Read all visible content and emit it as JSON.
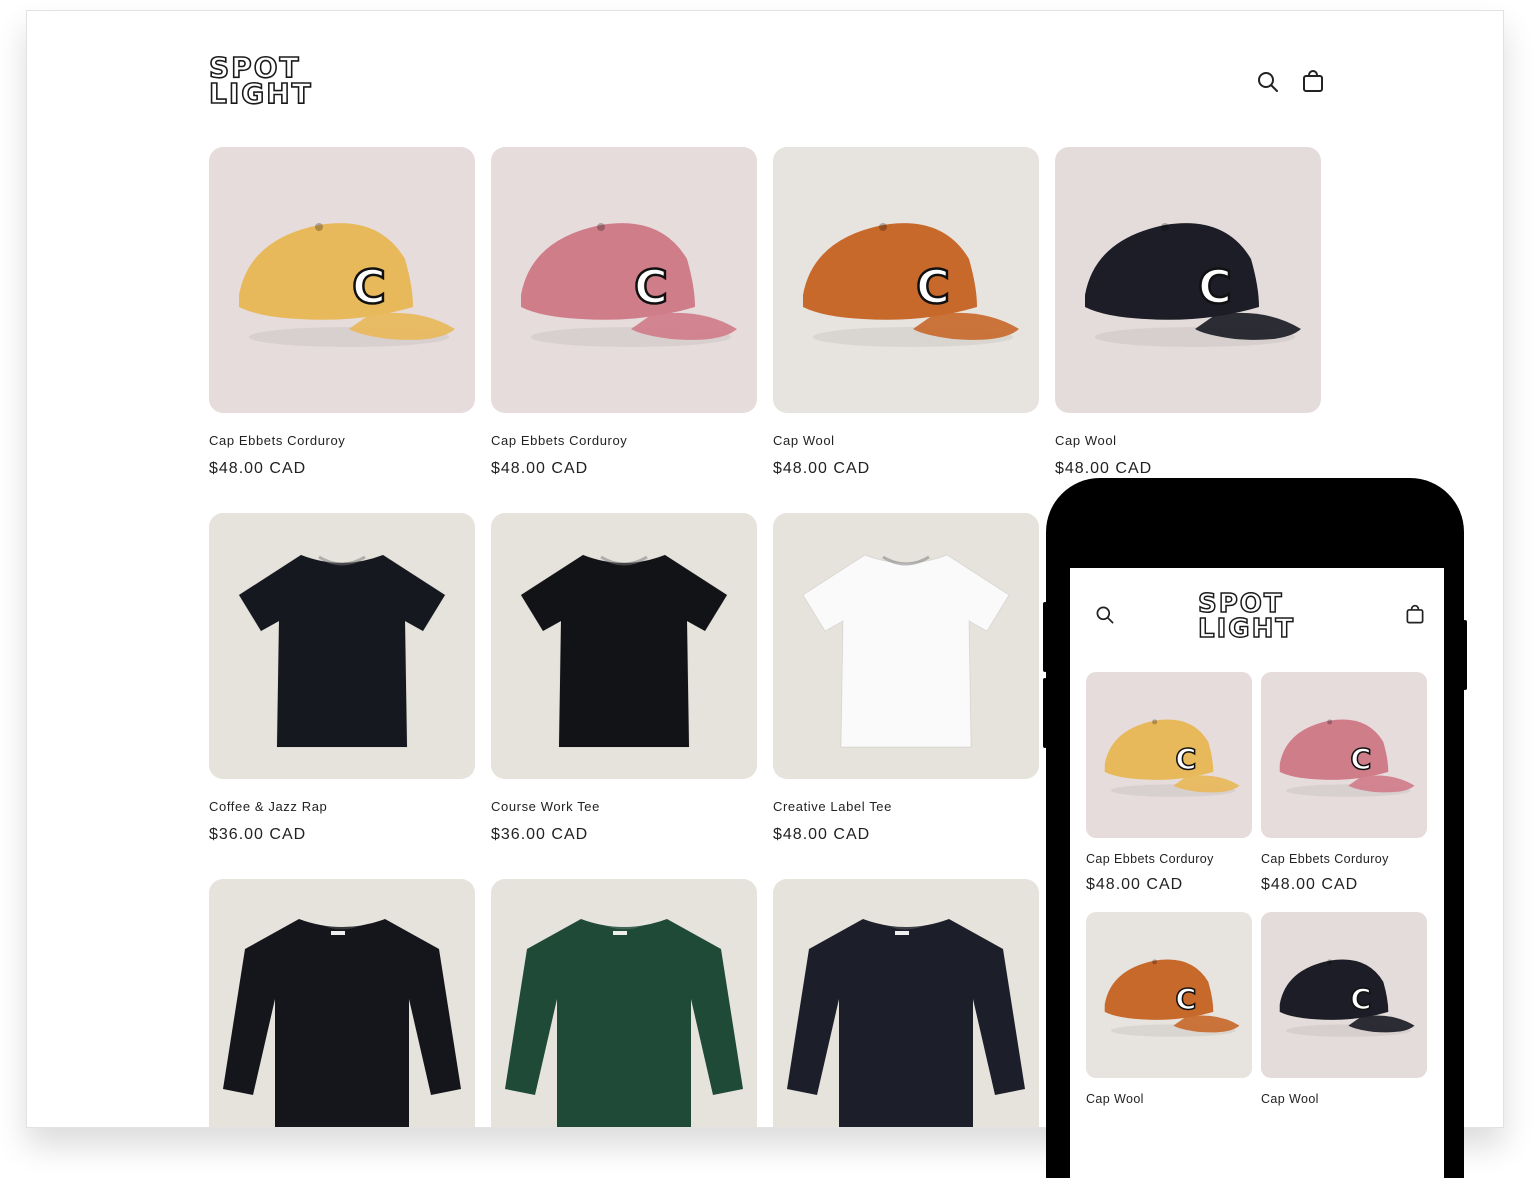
{
  "store": {
    "logo_line1": "SPOT",
    "logo_line2": "LIGHT"
  },
  "header": {
    "icons": [
      "search-icon",
      "cart-icon"
    ]
  },
  "products": [
    {
      "name": "Cap Ebbets Corduroy",
      "price": "$48.00 CAD",
      "kind": "cap",
      "color": "#e8b95a",
      "bg": "#e6dcdc"
    },
    {
      "name": "Cap Ebbets Corduroy",
      "price": "$48.00 CAD",
      "kind": "cap",
      "color": "#d07d8a",
      "bg": "#e6dcdc"
    },
    {
      "name": "Cap Wool",
      "price": "$48.00 CAD",
      "kind": "cap",
      "color": "#c8692c",
      "bg": "#e7e3df"
    },
    {
      "name": "Cap Wool",
      "price": "$48.00 CAD",
      "kind": "cap",
      "color": "#1c1d26",
      "bg": "#e4dcda"
    },
    {
      "name": "Coffee & Jazz Rap",
      "price": "$36.00 CAD",
      "kind": "tee",
      "color": "#15181f",
      "bg": "#e6e2dc"
    },
    {
      "name": "Course Work Tee",
      "price": "$36.00 CAD",
      "kind": "tee",
      "color": "#121316",
      "bg": "#e6e2dc"
    },
    {
      "name": "Creative Label Tee",
      "price": "$48.00 CAD",
      "kind": "tee",
      "color": "#fafafa",
      "bg": "#e6e2dc"
    },
    {
      "name": "",
      "price": "",
      "kind": "sweater",
      "color": "#15161b",
      "bg": "#e6e2dc"
    },
    {
      "name": "",
      "price": "",
      "kind": "sweater",
      "color": "#1f4a38",
      "bg": "#e6e2dc"
    },
    {
      "name": "",
      "price": "",
      "kind": "sweater",
      "color": "#1c1f2a",
      "bg": "#e6e2dc"
    }
  ],
  "mobile": {
    "logo_line1": "SPOT",
    "logo_line2": "LIGHT",
    "products": [
      {
        "name": "Cap Ebbets Corduroy",
        "price": "$48.00 CAD"
      },
      {
        "name": "Cap Ebbets Corduroy",
        "price": "$48.00 CAD"
      },
      {
        "name": "Cap Wool",
        "price": ""
      },
      {
        "name": "Cap Wool",
        "price": ""
      }
    ]
  }
}
